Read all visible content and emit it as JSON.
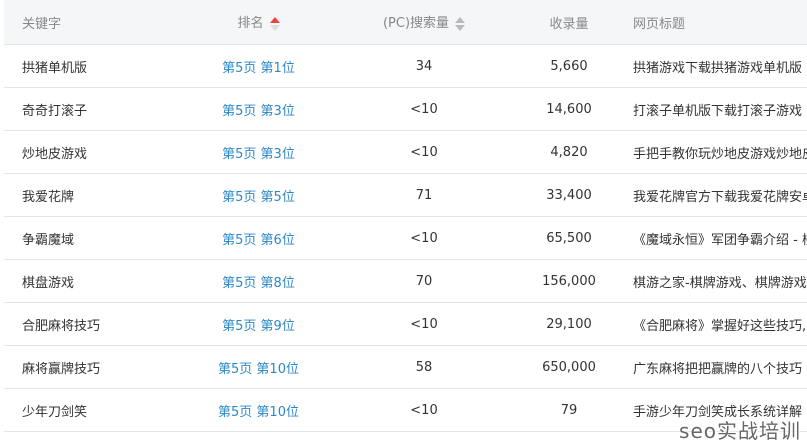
{
  "table": {
    "headers": {
      "keyword": "关键字",
      "rank": "排名",
      "search_volume": "(PC)搜索量",
      "indexed": "收录量",
      "page_title": "网页标题"
    },
    "rows": [
      {
        "keyword": "拱猪单机版",
        "rank": "第5页 第1位",
        "search_volume": "34",
        "indexed": "5,660",
        "page_title": "拱猪游戏下载拱猪游戏单机版"
      },
      {
        "keyword": "奇奇打滚子",
        "rank": "第5页 第3位",
        "search_volume": "<10",
        "indexed": "14,600",
        "page_title": "打滚子单机版下载打滚子游戏"
      },
      {
        "keyword": "炒地皮游戏",
        "rank": "第5页 第3位",
        "search_volume": "<10",
        "indexed": "4,820",
        "page_title": "手把手教你玩炒地皮游戏炒地皮"
      },
      {
        "keyword": "我爱花牌",
        "rank": "第5页 第5位",
        "search_volume": "71",
        "indexed": "33,400",
        "page_title": "我爱花牌官方下载我爱花牌安卓"
      },
      {
        "keyword": "争霸魔域",
        "rank": "第5页 第6位",
        "search_volume": "<10",
        "indexed": "65,500",
        "page_title": "《魔域永恒》军团争霸介绍 - 楼"
      },
      {
        "keyword": "棋盘游戏",
        "rank": "第5页 第8位",
        "search_volume": "70",
        "indexed": "156,000",
        "page_title": "棋游之家-棋牌游戏、棋牌游戏"
      },
      {
        "keyword": "合肥麻将技巧",
        "rank": "第5页 第9位",
        "search_volume": "<10",
        "indexed": "29,100",
        "page_title": "《合肥麻将》掌握好这些技巧,"
      },
      {
        "keyword": "麻将赢牌技巧",
        "rank": "第5页 第10位",
        "search_volume": "58",
        "indexed": "650,000",
        "page_title": "广东麻将把把赢牌的八个技巧"
      },
      {
        "keyword": "少年刀剑笑",
        "rank": "第5页 第10位",
        "search_volume": "<10",
        "indexed": "79",
        "page_title": "手游少年刀剑笑成长系统详解"
      }
    ]
  },
  "sort_icons": {
    "rank": "sort-ascending-active-icon",
    "search_volume": "sort-icon"
  },
  "colors": {
    "rank_link": "#2d88c7",
    "sort_active": "#e8463c",
    "header_bg": "#f5f6f8"
  },
  "watermark": "seo实战培训"
}
